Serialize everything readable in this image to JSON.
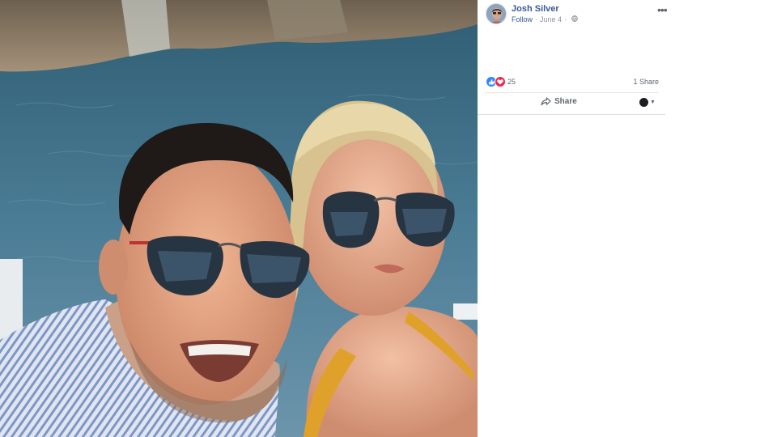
{
  "post": {
    "author": "Josh Silver",
    "follow_label": "Follow",
    "date": "June 4",
    "separator": "·",
    "privacy_icon": "globe-icon",
    "more_icon": "more-options-icon",
    "more_glyph": "•••"
  },
  "reactions": {
    "icons": [
      "like-reaction-icon",
      "love-reaction-icon"
    ],
    "count": "25",
    "shares": "1 Share",
    "colors": {
      "like": "#2d88ff",
      "love": "#f0284a"
    }
  },
  "actions": {
    "share_label": "Share",
    "share_icon": "share-arrow-icon",
    "audience_icon": "page-avatar-icon",
    "audience_caret": "▼"
  },
  "photo": {
    "description_icon": "selfie-photo",
    "colors": {
      "water": "#3d6f8c",
      "rocks": "#8a7a66",
      "skin": "#d79b7e",
      "shirt": "#a9b9d6",
      "swimsuit": "#e0a12a"
    }
  },
  "colors": {
    "link": "#385898",
    "meta": "#90949c",
    "text": "#606770"
  }
}
